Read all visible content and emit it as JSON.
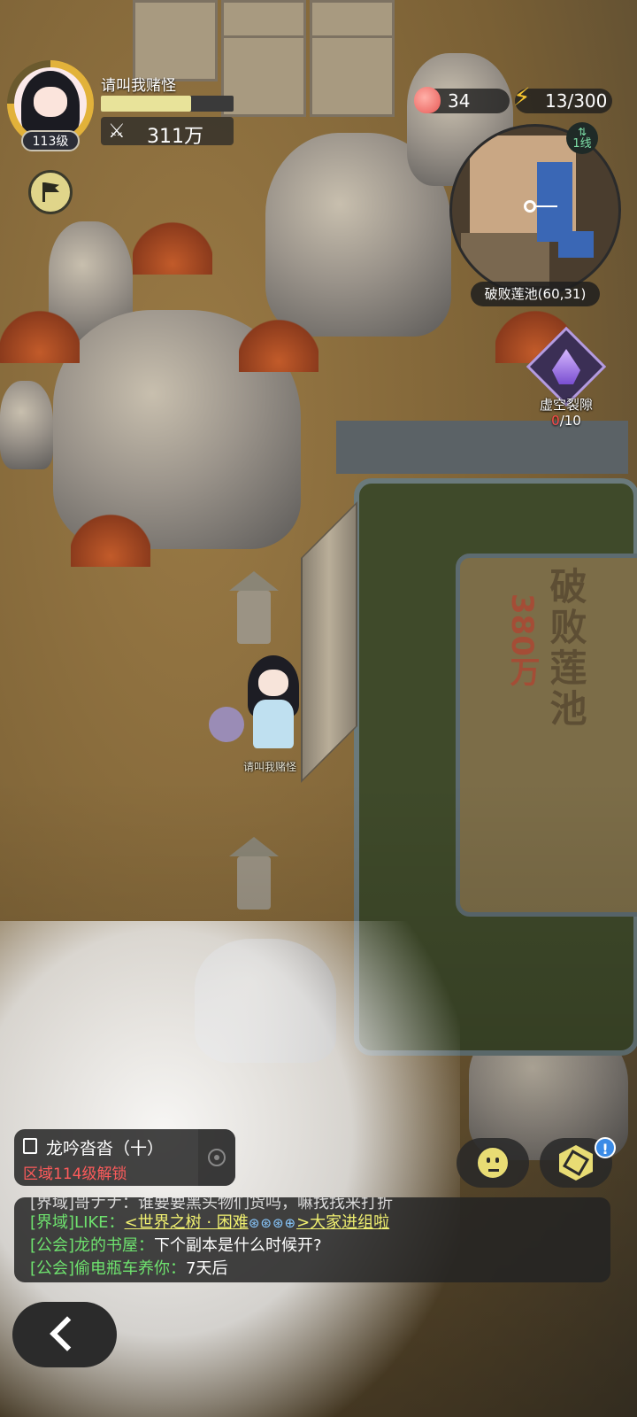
{
  "player": {
    "name": "请叫我赌怪",
    "level": "113级",
    "xp_fraction": 0.68,
    "power_icon": "crossed-swords-icon",
    "power": "311万"
  },
  "resources": {
    "peach": {
      "icon": "peach-icon",
      "value": "34"
    },
    "energy": {
      "icon": "lightning-icon",
      "value": "13/300"
    }
  },
  "minimap": {
    "line_label": "1线",
    "location": "破败莲池(60,31)"
  },
  "rift": {
    "label": "虚空裂隙",
    "current": "0",
    "total": "/10"
  },
  "zone": {
    "name": "破败莲池",
    "power": "380万"
  },
  "quest": {
    "title": "龙吟沓沓（十）",
    "subtitle": "区域114级解锁"
  },
  "chat": {
    "partial_line": "[界域]哥ナナ：谁要要黑头物们货吗，嘛找找来打折",
    "line1": {
      "channel": "[界域]LIKE：",
      "link": "<世界之树 · 困难",
      "icons": "⊛⊛⊛⊕",
      "tail": ">大家进组啦"
    },
    "line2": {
      "channel": "[公会]龙的书屋：",
      "text": "下个副本是什么时候开?"
    },
    "line3": {
      "channel": "[公会]偷电瓶车养你：",
      "text": "7天后"
    }
  },
  "notice_badge": "!",
  "colors": {
    "quest_locked": "#ff5b5b",
    "chat_channel": "#6ee26e",
    "rift_current": "#ff4b4b",
    "accent_yellow": "#e8dc74"
  }
}
